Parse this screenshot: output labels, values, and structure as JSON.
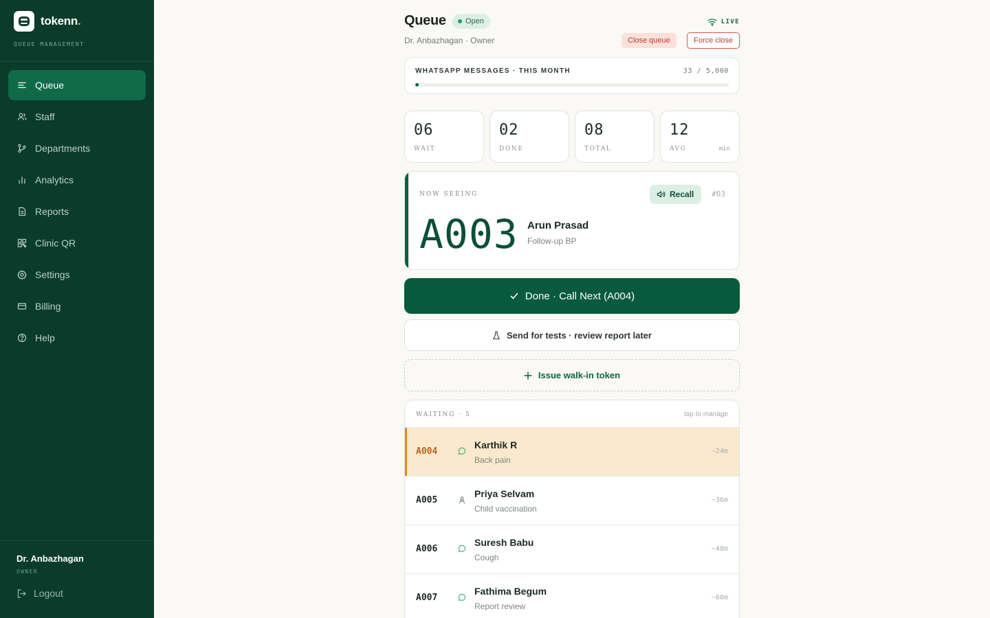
{
  "brand": {
    "name": "tokenn",
    "dot": ".",
    "subtitle": "QUEUE MANAGEMENT"
  },
  "nav": [
    {
      "label": "Queue",
      "icon": "queue-icon",
      "active": true
    },
    {
      "label": "Staff",
      "icon": "users-icon",
      "active": false
    },
    {
      "label": "Departments",
      "icon": "branch-icon",
      "active": false
    },
    {
      "label": "Analytics",
      "icon": "bar-chart-icon",
      "active": false
    },
    {
      "label": "Reports",
      "icon": "file-icon",
      "active": false
    },
    {
      "label": "Clinic QR",
      "icon": "qr-icon",
      "active": false
    },
    {
      "label": "Settings",
      "icon": "gear-icon",
      "active": false
    },
    {
      "label": "Billing",
      "icon": "card-icon",
      "active": false
    },
    {
      "label": "Help",
      "icon": "help-icon",
      "active": false
    }
  ],
  "user": {
    "name": "Dr. Anbazhagan",
    "role": "OWNER",
    "logout_label": "Logout"
  },
  "header": {
    "title": "Queue",
    "status": "Open",
    "subtitle": "Dr. Anbazhagan · Owner",
    "live_label": "LIVE",
    "close_queue_label": "Close queue",
    "force_close_label": "Force close"
  },
  "whatsapp": {
    "label": "WHATSAPP MESSAGES · THIS MONTH",
    "count_text": "33 / 5,000",
    "used": 33,
    "limit": 5000
  },
  "stats": [
    {
      "value": "06",
      "label": "WAIT",
      "unit": ""
    },
    {
      "value": "02",
      "label": "DONE",
      "unit": ""
    },
    {
      "value": "08",
      "label": "TOTAL",
      "unit": ""
    },
    {
      "value": "12",
      "label": "AVG",
      "unit": "min"
    }
  ],
  "now_seeing": {
    "label": "NOW SEEING",
    "recall_label": "Recall",
    "position": "#03",
    "token": "A003",
    "name": "Arun Prasad",
    "reason": "Follow-up BP"
  },
  "actions": {
    "done_label": "Done · Call Next (A004)",
    "tests_label": "Send for tests · review report later",
    "walkin_label": "Issue walk-in token"
  },
  "waiting": {
    "title": "WAITING · 5",
    "hint": "tap to manage",
    "rows": [
      {
        "token": "A004",
        "source": "whatsapp-icon",
        "name": "Karthik R",
        "reason": "Back pain",
        "eta": "~24m",
        "highlight": true
      },
      {
        "token": "A005",
        "source": "person-icon",
        "name": "Priya Selvam",
        "reason": "Child vaccination",
        "eta": "~36m",
        "highlight": false
      },
      {
        "token": "A006",
        "source": "whatsapp-icon",
        "name": "Suresh Babu",
        "reason": "Cough",
        "eta": "~48m",
        "highlight": false
      },
      {
        "token": "A007",
        "source": "whatsapp-icon",
        "name": "Fathima Begum",
        "reason": "Report review",
        "eta": "~60m",
        "highlight": false
      }
    ]
  },
  "colors": {
    "sidebar_bg": "#0b3b2b",
    "accent": "#085a3e",
    "active_nav": "#0f6a4a",
    "highlight_row": "#fbe9cd",
    "danger": "#c03a2f",
    "brand_dot": "#e8b33a"
  }
}
